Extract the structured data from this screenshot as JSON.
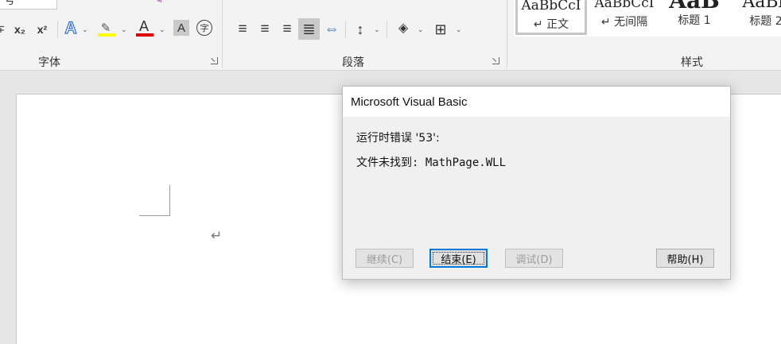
{
  "ribbon": {
    "font_group": {
      "label": "字体",
      "size_box_value": "号",
      "subscript_label": "x₂",
      "superscript_label": "x²",
      "text_effects_label": "A",
      "font_color_label": "A",
      "char_shading_label": "A",
      "enclosed_char_label": "字",
      "highlight_color": "#ffff00",
      "font_color": "#e00000"
    },
    "paragraph_group": {
      "label": "段落"
    },
    "styles_group": {
      "label": "样式",
      "items": [
        {
          "preview": "AaBbCcI",
          "name": "↵ 正文"
        },
        {
          "preview": "AaBbCcI",
          "name": "↵ 无间隔"
        },
        {
          "preview": "AaB",
          "name": "标题 1"
        },
        {
          "preview": "AaBb",
          "name": "标题 2"
        }
      ]
    }
  },
  "document": {
    "paragraph_mark": "↵"
  },
  "dialog": {
    "title": "Microsoft Visual Basic",
    "line1": "运行时错误 '53':",
    "line2": "文件未找到: MathPage.WLL",
    "buttons": {
      "continue": "继续(C)",
      "end": "结束(E)",
      "debug": "调试(D)",
      "help": "帮助(H)"
    }
  }
}
